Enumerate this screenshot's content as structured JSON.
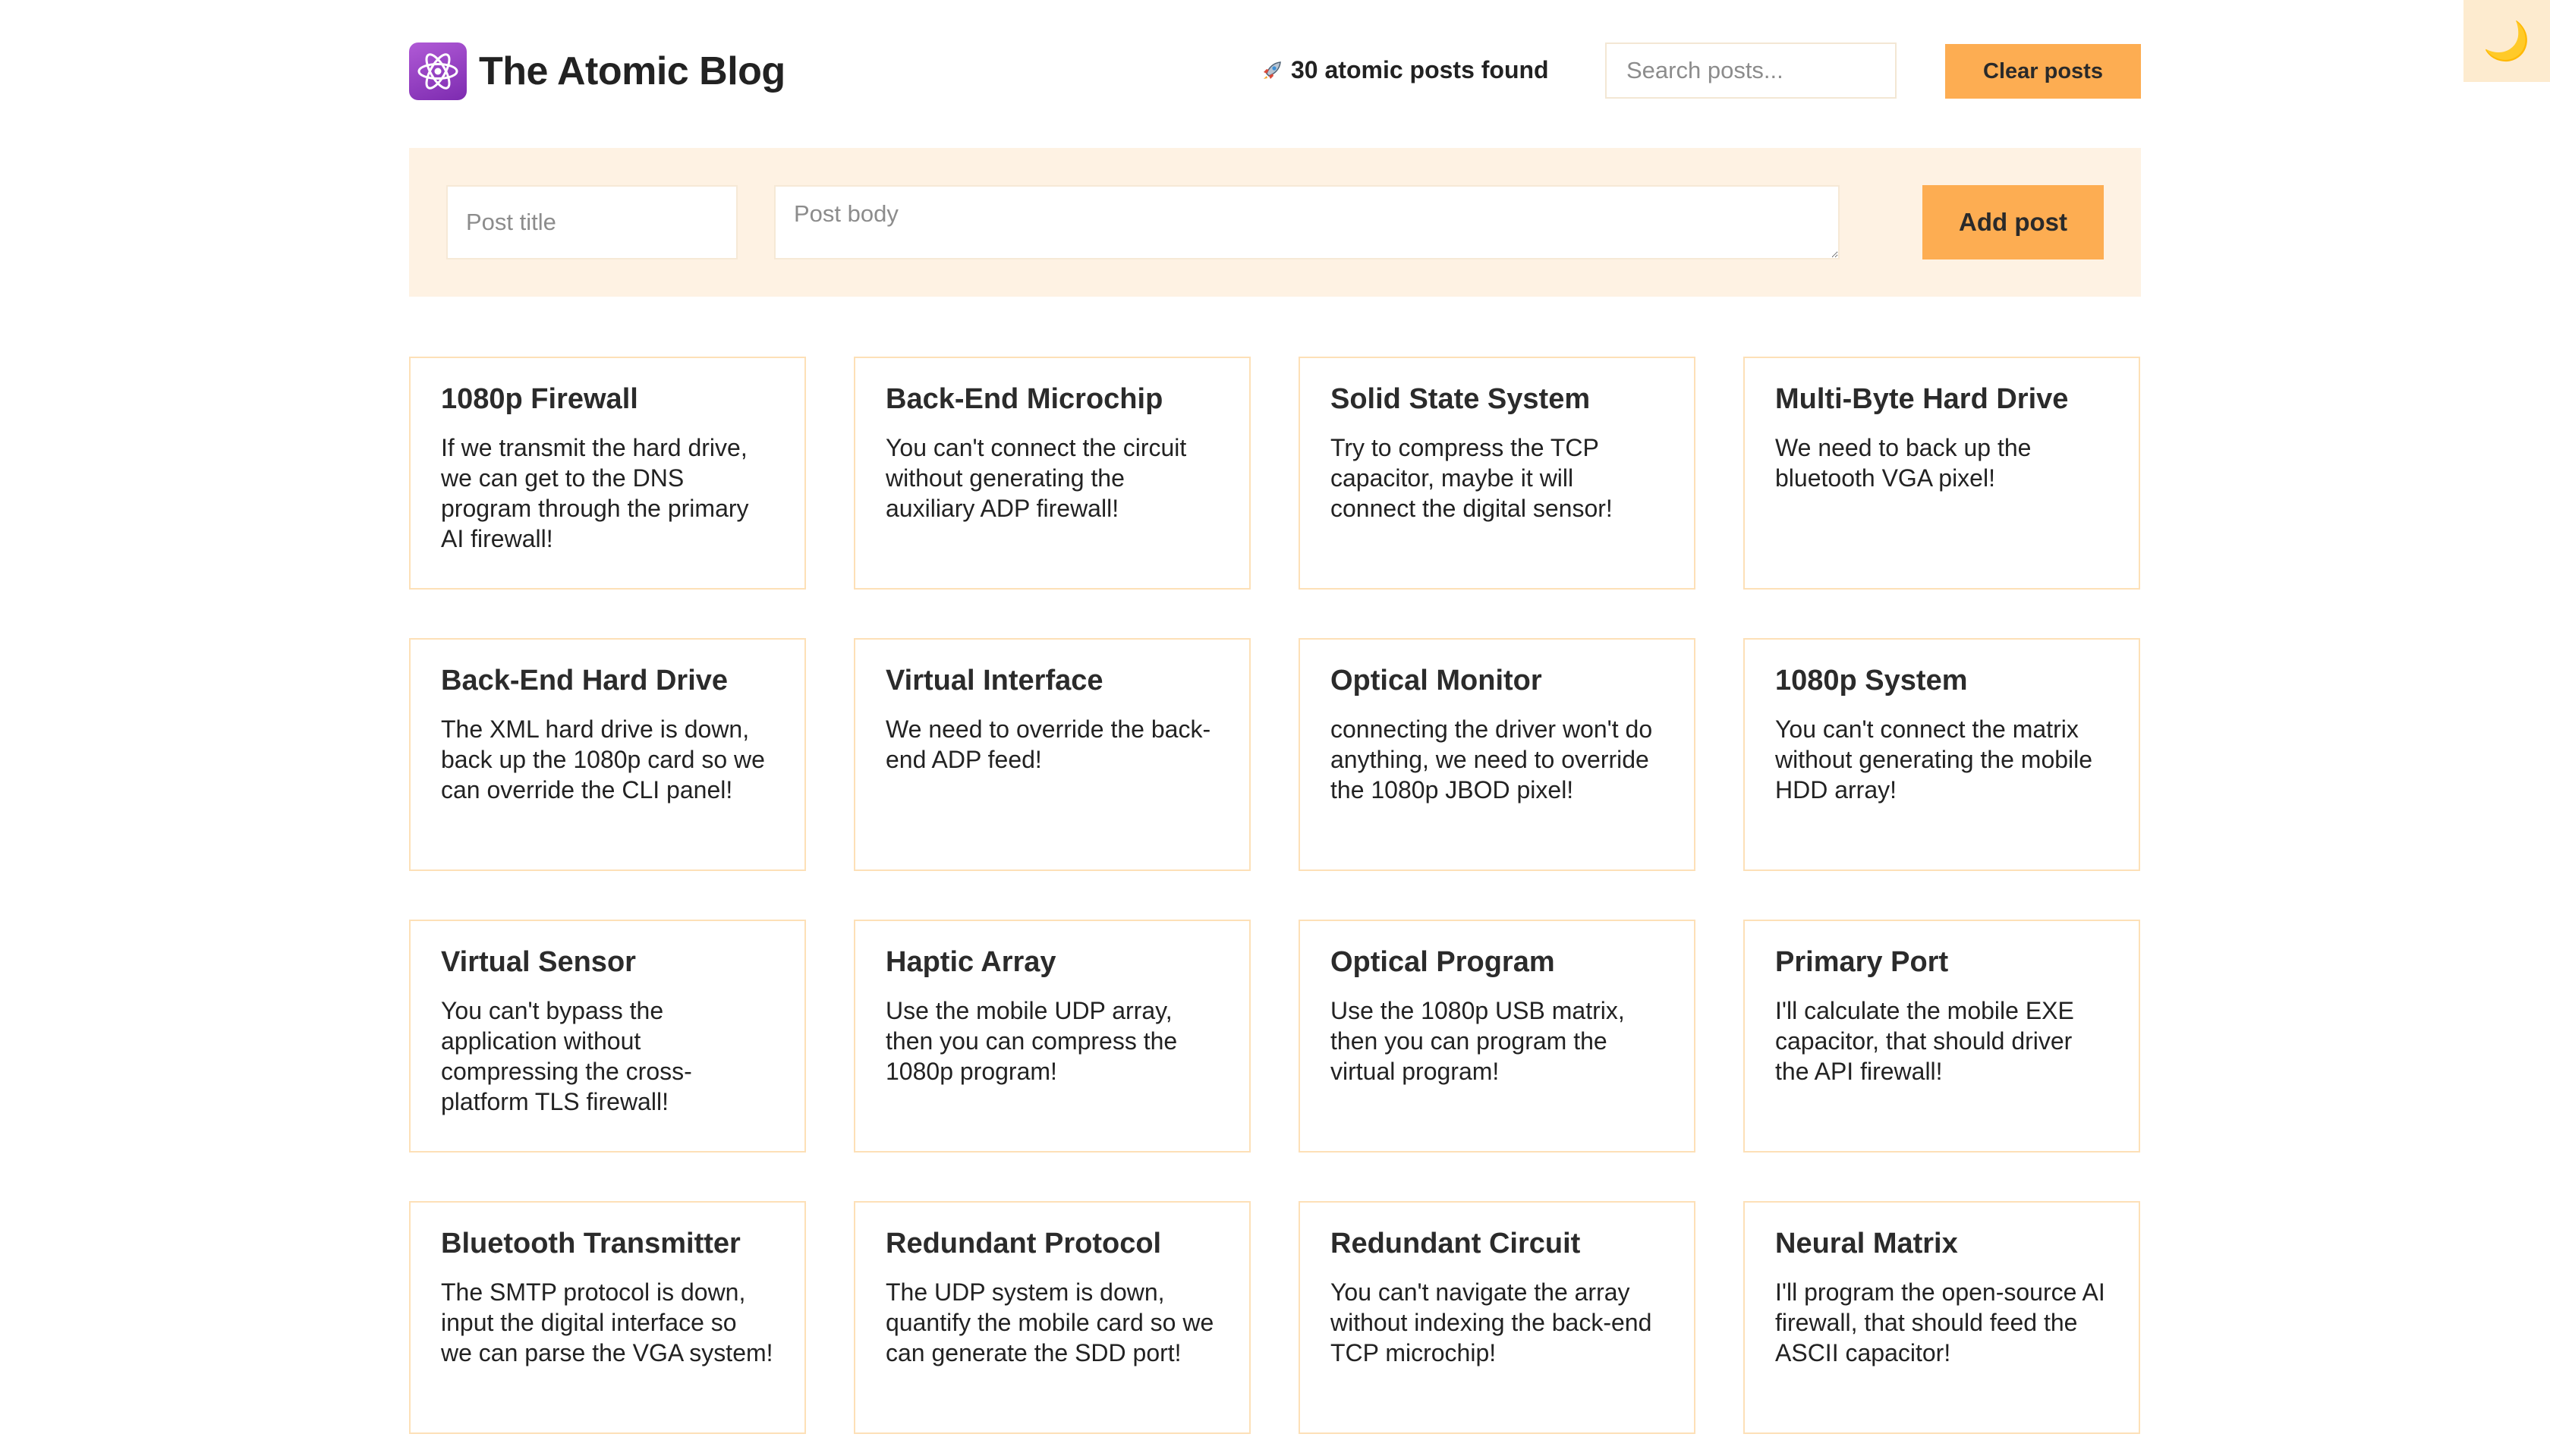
{
  "header": {
    "title": "The Atomic Blog",
    "logo_icon": "atom-icon",
    "post_count_icon": "rocket-icon",
    "post_count": "30 atomic posts found",
    "search_placeholder": "Search posts...",
    "clear_button": "Clear posts"
  },
  "theme_toggle": {
    "icon": "moon-icon",
    "glyph": "🌙"
  },
  "composer": {
    "title_placeholder": "Post title",
    "body_placeholder": "Post body",
    "add_button": "Add post"
  },
  "colors": {
    "accent": "#fdad52",
    "composer_bg": "#fef2e3",
    "card_border": "#fde0b7",
    "toggle_bg": "#fdebcf"
  },
  "posts": [
    {
      "title": "1080p Firewall",
      "body": "If we transmit the hard drive, we can get to the DNS program through the primary AI firewall!"
    },
    {
      "title": "Back-End Microchip",
      "body": "You can't connect the circuit without generating the auxiliary ADP firewall!"
    },
    {
      "title": "Solid State System",
      "body": "Try to compress the TCP capacitor, maybe it will connect the digital sensor!"
    },
    {
      "title": "Multi-Byte Hard Drive",
      "body": "We need to back up the bluetooth VGA pixel!"
    },
    {
      "title": "Back-End Hard Drive",
      "body": "The XML hard drive is down, back up the 1080p card so we can override the CLI panel!"
    },
    {
      "title": "Virtual Interface",
      "body": "We need to override the back-end ADP feed!"
    },
    {
      "title": "Optical Monitor",
      "body": "connecting the driver won't do anything, we need to override the 1080p JBOD pixel!"
    },
    {
      "title": "1080p System",
      "body": "You can't connect the matrix without generating the mobile HDD array!"
    },
    {
      "title": "Virtual Sensor",
      "body": "You can't bypass the application without compressing the cross-platform TLS firewall!"
    },
    {
      "title": "Haptic Array",
      "body": "Use the mobile UDP array, then you can compress the 1080p program!"
    },
    {
      "title": "Optical Program",
      "body": "Use the 1080p USB matrix, then you can program the virtual program!"
    },
    {
      "title": "Primary Port",
      "body": "I'll calculate the mobile EXE capacitor, that should driver the API firewall!"
    },
    {
      "title": "Bluetooth Transmitter",
      "body": "The SMTP protocol is down, input the digital interface so we can parse the VGA system!"
    },
    {
      "title": "Redundant Protocol",
      "body": "The UDP system is down, quantify the mobile card so we can generate the SDD port!"
    },
    {
      "title": "Redundant Circuit",
      "body": "You can't navigate the array without indexing the back-end TCP microchip!"
    },
    {
      "title": "Neural Matrix",
      "body": "I'll program the open-source AI firewall, that should feed the ASCII capacitor!"
    }
  ]
}
